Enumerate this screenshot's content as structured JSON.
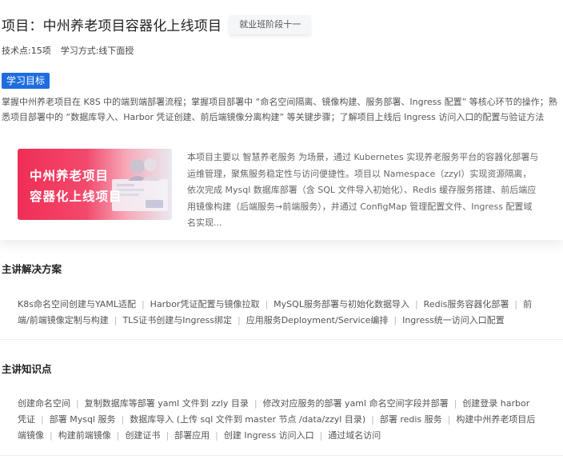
{
  "project": {
    "title": "项目：中州养老项目容器化上线项目",
    "stage_badge": "就业班阶段十一",
    "tech_points": "技术点:15项",
    "study_mode": "学习方式:线下面授"
  },
  "goal": {
    "tag": "学习目标",
    "text": "掌握中州养老项目在 K8S 中的端到端部署流程；掌握项目部署中 “命名空间隔离、镜像构建、服务部署、Ingress 配置” 等核心环节的操作；熟悉项目部署中的 “数据库导入、Harbor 凭证创建、前后端镜像分离构建” 等关键步骤；了解项目上线后 Ingress 访问入口的配置与验证方法"
  },
  "banner": {
    "line1": "中州养老项目",
    "line2": "容器化上线项目"
  },
  "intro": "本项目主要以 智慧养老服务 为场景，通过 Kubernetes 实现养老服务平台的容器化部署与运维管理，聚焦服务稳定性与访问便捷性。项目以 Namespace（zzyl）实现资源隔离，依次完成 Mysql 数据库部署（含 SQL 文件导入初始化）、Redis 缓存服务搭建、前后端应用镜像构建（后端服务→前端服务），并通过 ConfigMap 管理配置文件、Ingress 配置域名实现...",
  "solutions": {
    "title": "主讲解决方案",
    "items": [
      "K8s命名空间创建与YAML适配",
      "Harbor凭证配置与镜像拉取",
      "MySQL服务部署与初始化数据导入",
      "Redis服务容器化部署",
      "前端/前端镜像定制与构建",
      "TLS证书创建与Ingress绑定",
      "应用服务Deployment/Service编排",
      "Ingress统一访问入口配置"
    ]
  },
  "knowledge": {
    "title": "主讲知识点",
    "items": [
      "创建命名空间",
      "复制数据库等部署 yaml 文件到 zzly 目录",
      "修改对应服务的部署 yaml 命名空间字段并部署",
      "创建登录 harbor 凭证",
      "部署 Mysql 服务",
      "数据库导入 (上传 sql 文件到 master 节点 /data/zzyl 目录)",
      "部署 redis 服务",
      "构建中州养老项目后端镜像",
      "构建前端镜像",
      "创建证书",
      "部署应用",
      "创建 Ingress 访问入口",
      "通过域名访问"
    ]
  },
  "colors": {
    "accent": "#1e6de0",
    "banner": "#f02d55"
  }
}
